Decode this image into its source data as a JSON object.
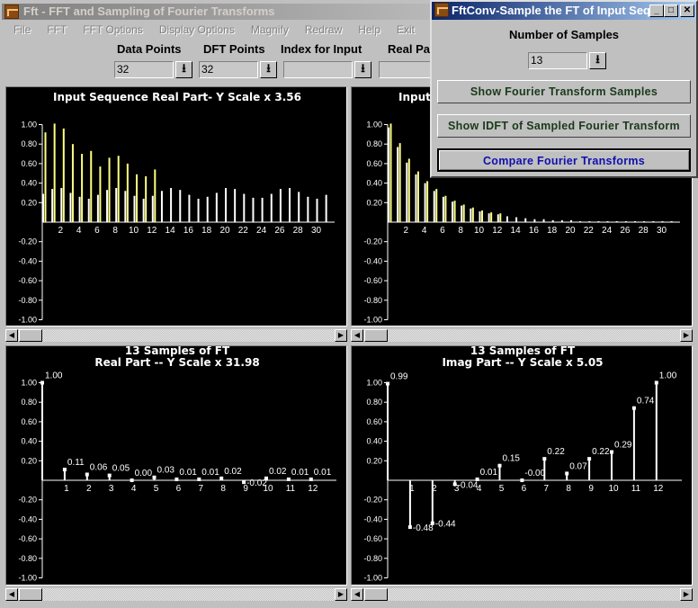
{
  "window": {
    "title": "Fft - FFT and Sampling of Fourier Transforms"
  },
  "menu": [
    "File",
    "FFT",
    "FFT Options",
    "Display Options",
    "Magnify",
    "Redraw",
    "Help",
    "Exit"
  ],
  "toolbar": {
    "data_points": {
      "label": "Data Points",
      "value": "32"
    },
    "dft_points": {
      "label": "DFT Points",
      "value": "32"
    },
    "index_for_input": {
      "label": "Index for Input",
      "value": ""
    },
    "real_part": {
      "label": "Real Pa",
      "value": ""
    }
  },
  "dialog": {
    "title": "FftConv-Sample the FT of Input Seq...",
    "samples_label": "Number of Samples",
    "samples_value": "13",
    "buttons": [
      "Show Fourier Transform Samples",
      "Show IDFT of Sampled Fourier Transform",
      "Compare Fourier Transforms"
    ]
  },
  "colors": {
    "primary_series": "#ffffff",
    "secondary_series": "#ffff80",
    "background": "#000000",
    "compare_button_text": "#1010b0"
  },
  "chart_data": [
    {
      "id": "top-left",
      "type": "bar",
      "title": "Input Sequence Real Part- Y Scale x    3.56",
      "ylim": [
        -1,
        1
      ],
      "yticks": [
        "1.00",
        "0.80",
        "0.60",
        "0.40",
        "0.20",
        "-0.20",
        "-0.40",
        "-0.60",
        "-0.80",
        "-1.00"
      ],
      "xticks": [
        2,
        4,
        6,
        8,
        10,
        12,
        14,
        16,
        18,
        20,
        22,
        24,
        26,
        28,
        30
      ],
      "series": [
        {
          "color": "#ffffff",
          "values": [
            0.29,
            0.34,
            0.35,
            0.3,
            0.26,
            0.24,
            0.28,
            0.33,
            0.35,
            0.32,
            0.27,
            0.24,
            0.27,
            0.32,
            0.35,
            0.33,
            0.28,
            0.24,
            0.26,
            0.3,
            0.35,
            0.34,
            0.29,
            0.25,
            0.25,
            0.29,
            0.34,
            0.35,
            0.31,
            0.26,
            0.24,
            0.28
          ]
        },
        {
          "color": "#ffff80",
          "values": [
            0.92,
            1.01,
            0.96,
            0.8,
            0.7,
            0.73,
            0.57,
            0.66,
            0.68,
            0.6,
            0.49,
            0.47,
            0.54
          ]
        }
      ]
    },
    {
      "id": "top-right",
      "type": "bar",
      "title": "Input",
      "ylim": [
        -1,
        1
      ],
      "yticks": [
        "1.00",
        "0.80",
        "0.60",
        "0.40",
        "0.20",
        "-0.20",
        "-0.40",
        "-0.60",
        "-0.80",
        "-1.00"
      ],
      "xticks": [
        2,
        4,
        6,
        8,
        10,
        12,
        14,
        16,
        18,
        20,
        22,
        24,
        26,
        28,
        30
      ],
      "series": [
        {
          "color": "#ffffff",
          "values": [
            0.97,
            0.77,
            0.61,
            0.49,
            0.4,
            0.32,
            0.26,
            0.21,
            0.17,
            0.14,
            0.11,
            0.09,
            0.08,
            0.06,
            0.05,
            0.04,
            0.03,
            0.03,
            0.02,
            0.02,
            0.02,
            0.01,
            0.01,
            0.01,
            0.01,
            0.01,
            0.01,
            0.01,
            0.01,
            0.01,
            0.01,
            0.01
          ]
        },
        {
          "color": "#ffff80",
          "values": [
            1.01,
            0.81,
            0.65,
            0.52,
            0.42,
            0.34,
            0.27,
            0.22,
            0.18,
            0.15,
            0.12,
            0.1,
            0.09
          ]
        }
      ]
    },
    {
      "id": "bottom-left",
      "type": "stem",
      "title": "13 Samples of FT",
      "subtitle": "Real Part -- Y Scale x   31.98",
      "ylim": [
        -1,
        1
      ],
      "yticks": [
        "1.00",
        "0.80",
        "0.60",
        "0.40",
        "0.20",
        "-0.20",
        "-0.40",
        "-0.60",
        "-0.80",
        "-1.00"
      ],
      "xticks": [
        1,
        2,
        3,
        4,
        5,
        6,
        7,
        8,
        9,
        10,
        11,
        12
      ],
      "values": [
        1.0,
        0.11,
        0.06,
        0.05,
        0.0,
        0.03,
        0.01,
        0.01,
        0.02,
        -0.02,
        0.02,
        0.01,
        0.01
      ],
      "labels": [
        "1.00",
        "0.11",
        "0.06",
        "0.05",
        "0.00",
        "0.03",
        "0.01",
        "0.01",
        "0.02",
        "-0.02",
        "0.02",
        "0.01",
        "0.01"
      ]
    },
    {
      "id": "bottom-right",
      "type": "stem",
      "title": "13 Samples of FT",
      "subtitle": "Imag Part -- Y Scale x    5.05",
      "ylim": [
        -1,
        1
      ],
      "yticks": [
        "1.00",
        "0.80",
        "0.60",
        "0.40",
        "0.20",
        "-0.20",
        "-0.40",
        "-0.60",
        "-0.80",
        "-1.00"
      ],
      "xticks": [
        1,
        2,
        3,
        4,
        5,
        6,
        7,
        8,
        9,
        10,
        11,
        12
      ],
      "values": [
        0.99,
        -0.48,
        -0.44,
        -0.04,
        0.01,
        0.15,
        -0.0,
        0.22,
        0.07,
        0.22,
        0.29,
        0.74,
        1.0
      ],
      "labels": [
        "0.99",
        "-0.48",
        "-0.44",
        "-0.04",
        "0.01",
        "0.15",
        "-0.00",
        "0.22",
        "0.07",
        "0.22",
        "0.29",
        "0.74",
        "1.00"
      ]
    }
  ]
}
